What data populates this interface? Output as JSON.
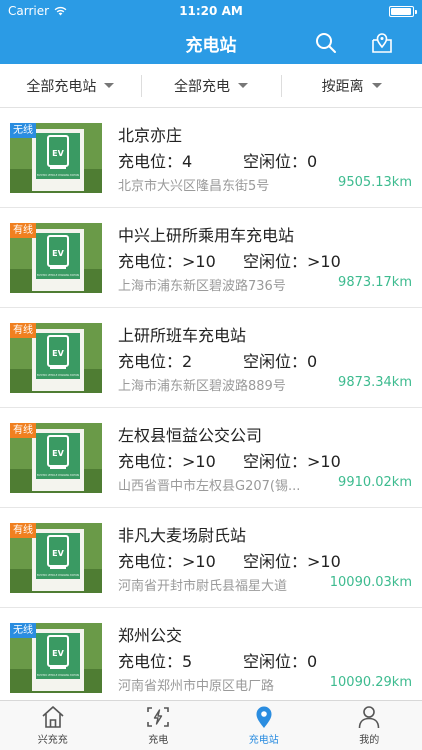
{
  "status": {
    "carrier": "Carrier",
    "time": "11:20 AM",
    "battery_level": 0.95
  },
  "header": {
    "title": "充电站"
  },
  "filters": [
    {
      "label": "全部充电站"
    },
    {
      "label": "全部充电"
    },
    {
      "label": "按距离"
    }
  ],
  "labels": {
    "chargers": "充电位：",
    "idle": "空闲位："
  },
  "stations": [
    {
      "tag": "无线",
      "tag_type": "offline",
      "name": "北京亦庄",
      "chargers": "4",
      "idle": "0",
      "address": "北京市大兴区隆昌东街5号",
      "distance": "9505.13km"
    },
    {
      "tag": "有线",
      "tag_type": "online",
      "name": "中兴上研所乘用车充电站",
      "chargers": ">10",
      "idle": ">10",
      "address": "上海市浦东新区碧波路736号",
      "distance": "9873.17km"
    },
    {
      "tag": "有线",
      "tag_type": "online",
      "name": "上研所班车充电站",
      "chargers": "2",
      "idle": "0",
      "address": "上海市浦东新区碧波路889号",
      "distance": "9873.34km"
    },
    {
      "tag": "有线",
      "tag_type": "online",
      "name": "左权县恒益公交公司",
      "chargers": ">10",
      "idle": ">10",
      "address": "山西省晋中市左权县G207(锡...",
      "distance": "9910.02km"
    },
    {
      "tag": "有线",
      "tag_type": "online",
      "name": "非凡大麦场尉氏站",
      "chargers": ">10",
      "idle": ">10",
      "address": "河南省开封市尉氏县福星大道",
      "distance": "10090.03km"
    },
    {
      "tag": "无线",
      "tag_type": "offline",
      "name": "郑州公交",
      "chargers": "5",
      "idle": "0",
      "address": "河南省郑州市中原区电厂路",
      "distance": "10090.29km"
    }
  ],
  "thumb_text": {
    "ev": "EV",
    "caption": "ELECTRIC VEHICLE CHARGING STATION"
  },
  "tabs": [
    {
      "label": "兴充充",
      "icon": "house-icon"
    },
    {
      "label": "充电",
      "icon": "charge-scan-icon"
    },
    {
      "label": "充电站",
      "icon": "location-pin-icon"
    },
    {
      "label": "我的",
      "icon": "person-icon"
    }
  ],
  "active_tab": 2,
  "colors": {
    "header": "#2b9be5",
    "accent": "#2b8de0",
    "distance": "#3dbb8f",
    "online_tag": "#f08020",
    "offline_tag": "#2b8de0"
  }
}
